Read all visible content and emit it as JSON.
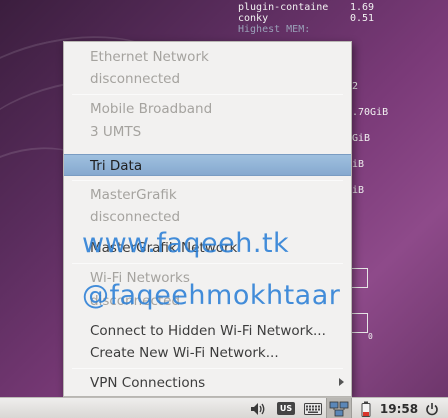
{
  "conky": {
    "process_rows": [
      {
        "name": "plugin-containe",
        "value": "1.69"
      },
      {
        "name": "conky",
        "value": "0.51"
      }
    ],
    "section_label": "Highest MEM:",
    "side_values": [
      "2",
      ".70GiB",
      "GiB",
      "iB",
      "iB"
    ],
    "graph_zero_label": "0"
  },
  "network_menu": {
    "ethernet": {
      "label": "Ethernet Network",
      "status": "disconnected"
    },
    "mobile": {
      "label": "Mobile Broadband",
      "status": "3 UMTS"
    },
    "selected_connection": "Tri Data",
    "mastergrafik": {
      "label": "MasterGrafik",
      "status": "disconnected"
    },
    "mastergrafik_network": "MasterGrafik Network",
    "wifi": {
      "label": "Wi-Fi Networks",
      "status": "disconnected"
    },
    "connect_hidden": "Connect to Hidden Wi-Fi Network...",
    "create_new": "Create New Wi-Fi Network...",
    "vpn": "VPN Connections"
  },
  "watermark": {
    "site": "www.faqeeh.tk",
    "handle": "@faqeehmokhtaar"
  },
  "panel": {
    "keyboard_layout": "US",
    "clock": "19:58",
    "icons": [
      "volume-icon",
      "keyboard-layout-icon",
      "keyboard-icon",
      "network-icon",
      "battery-icon",
      "power-icon"
    ]
  }
}
